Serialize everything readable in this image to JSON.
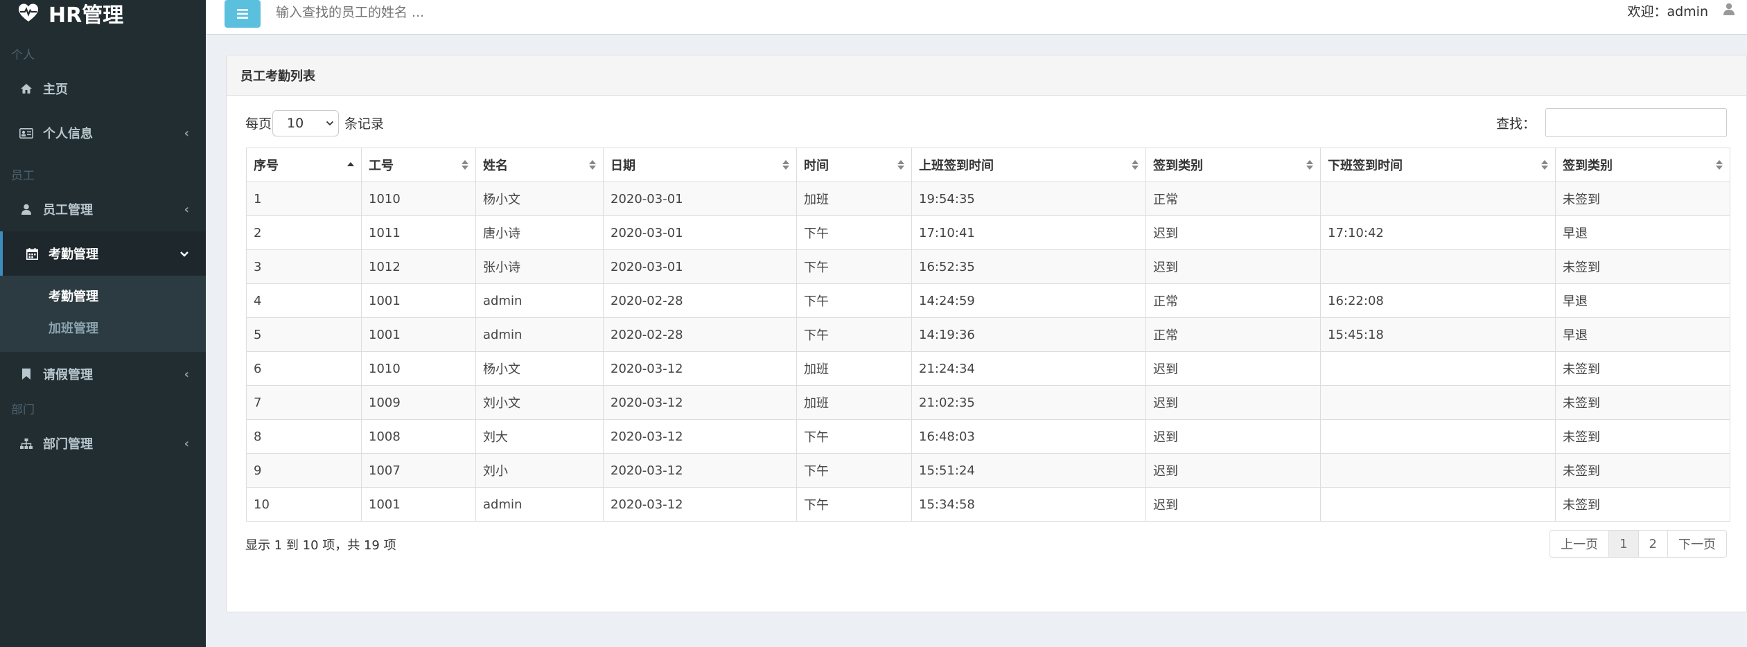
{
  "brand": {
    "title": "HR管理"
  },
  "sidebar": {
    "sections": [
      {
        "label": "个人"
      },
      {
        "label": "员工"
      },
      {
        "label": "部门"
      }
    ],
    "items": [
      {
        "label": "主页"
      },
      {
        "label": "个人信息"
      },
      {
        "label": "员工管理"
      },
      {
        "label": "考勤管理"
      },
      {
        "label": "请假管理"
      },
      {
        "label": "部门管理"
      }
    ],
    "sub_items": [
      {
        "label": "考勤管理"
      },
      {
        "label": "加班管理"
      }
    ]
  },
  "topbar": {
    "search_placeholder": "输入查找的员工的姓名 ...",
    "welcome": "欢迎：admin"
  },
  "panel": {
    "title": "员工考勤列表",
    "length_prefix": "每页",
    "length_value": "10",
    "length_suffix": "条记录",
    "find_label": "查找：",
    "info": "显示 1 到 10 项，共 19 项",
    "pager": {
      "prev": "上一页",
      "p1": "1",
      "p2": "2",
      "next": "下一页"
    }
  },
  "table": {
    "headers": [
      "序号",
      "工号",
      "姓名",
      "日期",
      "时间",
      "上班签到时间",
      "签到类别",
      "下班签到时间",
      "签到类别"
    ],
    "rows": [
      [
        "1",
        "1010",
        "杨小文",
        "2020-03-01",
        "加班",
        "19:54:35",
        "正常",
        "",
        "未签到"
      ],
      [
        "2",
        "1011",
        "唐小诗",
        "2020-03-01",
        "下午",
        "17:10:41",
        "迟到",
        "17:10:42",
        "早退"
      ],
      [
        "3",
        "1012",
        "张小诗",
        "2020-03-01",
        "下午",
        "16:52:35",
        "迟到",
        "",
        "未签到"
      ],
      [
        "4",
        "1001",
        "admin",
        "2020-02-28",
        "下午",
        "14:24:59",
        "正常",
        "16:22:08",
        "早退"
      ],
      [
        "5",
        "1001",
        "admin",
        "2020-02-28",
        "下午",
        "14:19:36",
        "正常",
        "15:45:18",
        "早退"
      ],
      [
        "6",
        "1010",
        "杨小文",
        "2020-03-12",
        "加班",
        "21:24:34",
        "迟到",
        "",
        "未签到"
      ],
      [
        "7",
        "1009",
        "刘小文",
        "2020-03-12",
        "加班",
        "21:02:35",
        "迟到",
        "",
        "未签到"
      ],
      [
        "8",
        "1008",
        "刘大",
        "2020-03-12",
        "下午",
        "16:48:03",
        "迟到",
        "",
        "未签到"
      ],
      [
        "9",
        "1007",
        "刘小",
        "2020-03-12",
        "下午",
        "15:51:24",
        "迟到",
        "",
        "未签到"
      ],
      [
        "10",
        "1001",
        "admin",
        "2020-03-12",
        "下午",
        "15:34:58",
        "迟到",
        "",
        "未签到"
      ]
    ]
  }
}
